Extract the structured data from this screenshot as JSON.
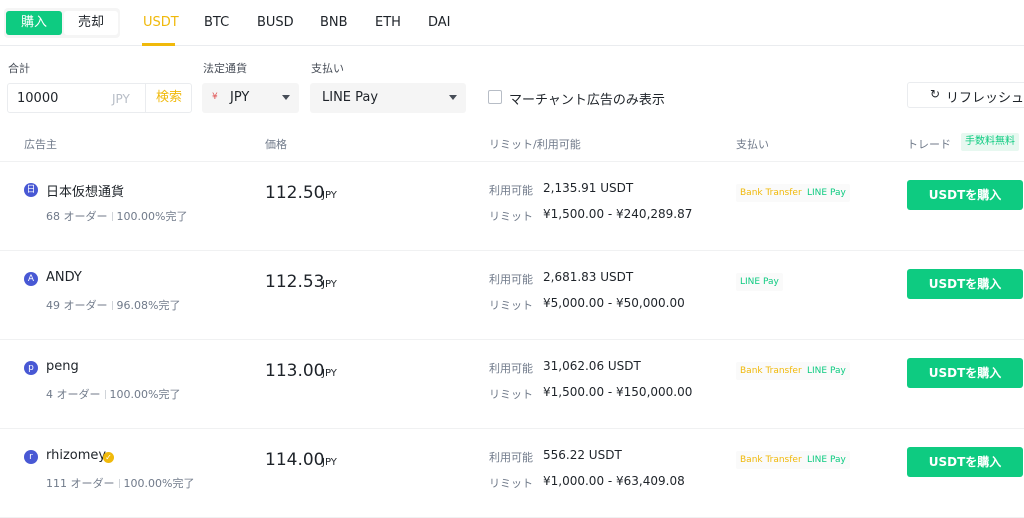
{
  "trade_side": {
    "buy": "購入",
    "sell": "売却"
  },
  "asset_tabs": [
    "USDT",
    "BTC",
    "BUSD",
    "BNB",
    "ETH",
    "DAI"
  ],
  "active_asset": "USDT",
  "filters": {
    "amount_label": "合計",
    "amount_value": "10000",
    "amount_unit": "JPY",
    "search_label": "検索",
    "fiat_label": "法定通貨",
    "fiat_icon": "¥",
    "fiat_value": "JPY",
    "payment_label": "支払い",
    "payment_value": "LINE Pay",
    "merchant_only_label": "マーチャント広告のみ表示",
    "refresh_label": "リフレッシュ"
  },
  "table_header": {
    "advertiser": "広告主",
    "price": "価格",
    "limit": "リミット/利用可能",
    "payment": "支払い",
    "trade": "トレード",
    "fee_badge": "手数料無料"
  },
  "labels": {
    "available": "利用可能",
    "limit": "リミット"
  },
  "colors": {
    "accent": "#f0b90b",
    "buy_green": "#0ecb81"
  },
  "rows": [
    {
      "avatar": "日",
      "name": "日本仮想通貨",
      "verified": false,
      "orders": "68 オーダー",
      "completion": "100.00%完了",
      "price": "112.50",
      "currency": "JPY",
      "available": "2,135.91 USDT",
      "limit": "¥1,500.00 - ¥240,289.87",
      "payments": [
        "Bank Transfer",
        "LINE Pay"
      ],
      "button": "USDTを購入"
    },
    {
      "avatar": "A",
      "name": "ANDY",
      "verified": false,
      "orders": "49 オーダー",
      "completion": "96.08%完了",
      "price": "112.53",
      "currency": "JPY",
      "available": "2,681.83 USDT",
      "limit": "¥5,000.00 - ¥50,000.00",
      "payments": [
        "LINE Pay"
      ],
      "button": "USDTを購入"
    },
    {
      "avatar": "p",
      "name": "peng",
      "verified": false,
      "orders": "4 オーダー",
      "completion": "100.00%完了",
      "price": "113.00",
      "currency": "JPY",
      "available": "31,062.06 USDT",
      "limit": "¥1,500.00 - ¥150,000.00",
      "payments": [
        "Bank Transfer",
        "LINE Pay"
      ],
      "button": "USDTを購入"
    },
    {
      "avatar": "r",
      "name": "rhizomey",
      "verified": true,
      "orders": "111 オーダー",
      "completion": "100.00%完了",
      "price": "114.00",
      "currency": "JPY",
      "available": "556.22 USDT",
      "limit": "¥1,000.00 - ¥63,409.08",
      "payments": [
        "Bank Transfer",
        "LINE Pay"
      ],
      "button": "USDTを購入"
    }
  ]
}
